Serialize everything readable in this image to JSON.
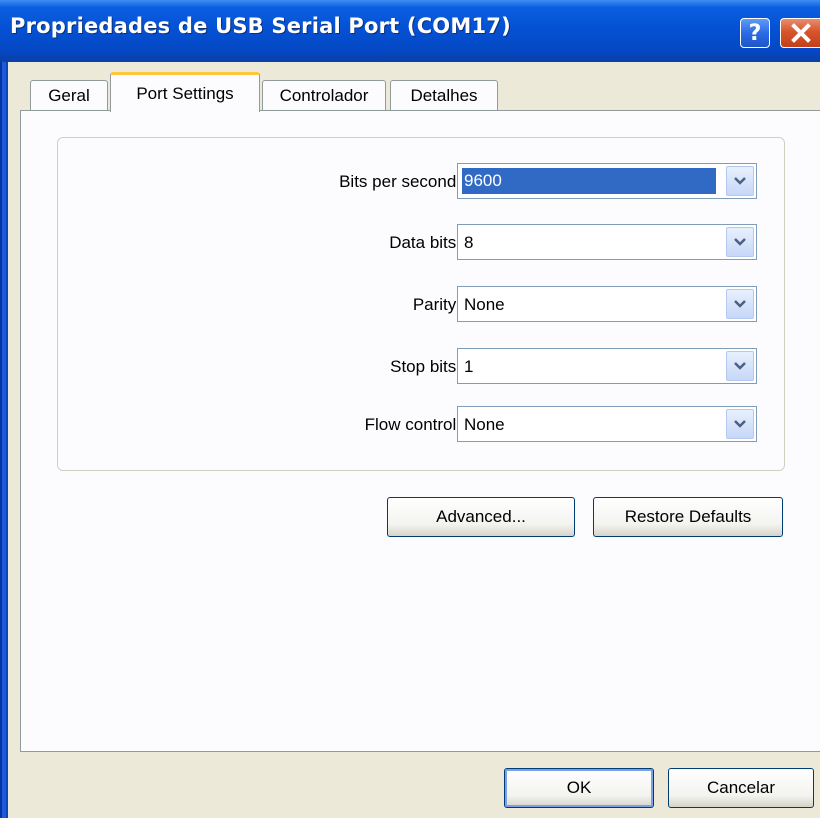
{
  "window": {
    "title": "Propriedades de USB Serial Port (COM17)",
    "help_glyph": "?",
    "title_bar_color": "#0551d4"
  },
  "tabs": [
    {
      "label": "Geral",
      "active": false
    },
    {
      "label": "Port Settings",
      "active": true
    },
    {
      "label": "Controlador",
      "active": false
    },
    {
      "label": "Detalhes",
      "active": false
    }
  ],
  "settings": {
    "bits_per_second": {
      "label": "Bits per second:",
      "value": "9600"
    },
    "data_bits": {
      "label": "Data bits:",
      "value": "8"
    },
    "parity": {
      "label": "Parity:",
      "value": "None"
    },
    "stop_bits": {
      "label": "Stop bits:",
      "value": "1"
    },
    "flow_control": {
      "label": "Flow control:",
      "value": "None"
    }
  },
  "buttons": {
    "advanced": "Advanced...",
    "restore_defaults": "Restore Defaults",
    "ok": "OK",
    "cancel": "Cancelar"
  },
  "icons": {
    "help": "help-icon",
    "close": "close-icon",
    "dropdown": "chevron-down-icon"
  }
}
